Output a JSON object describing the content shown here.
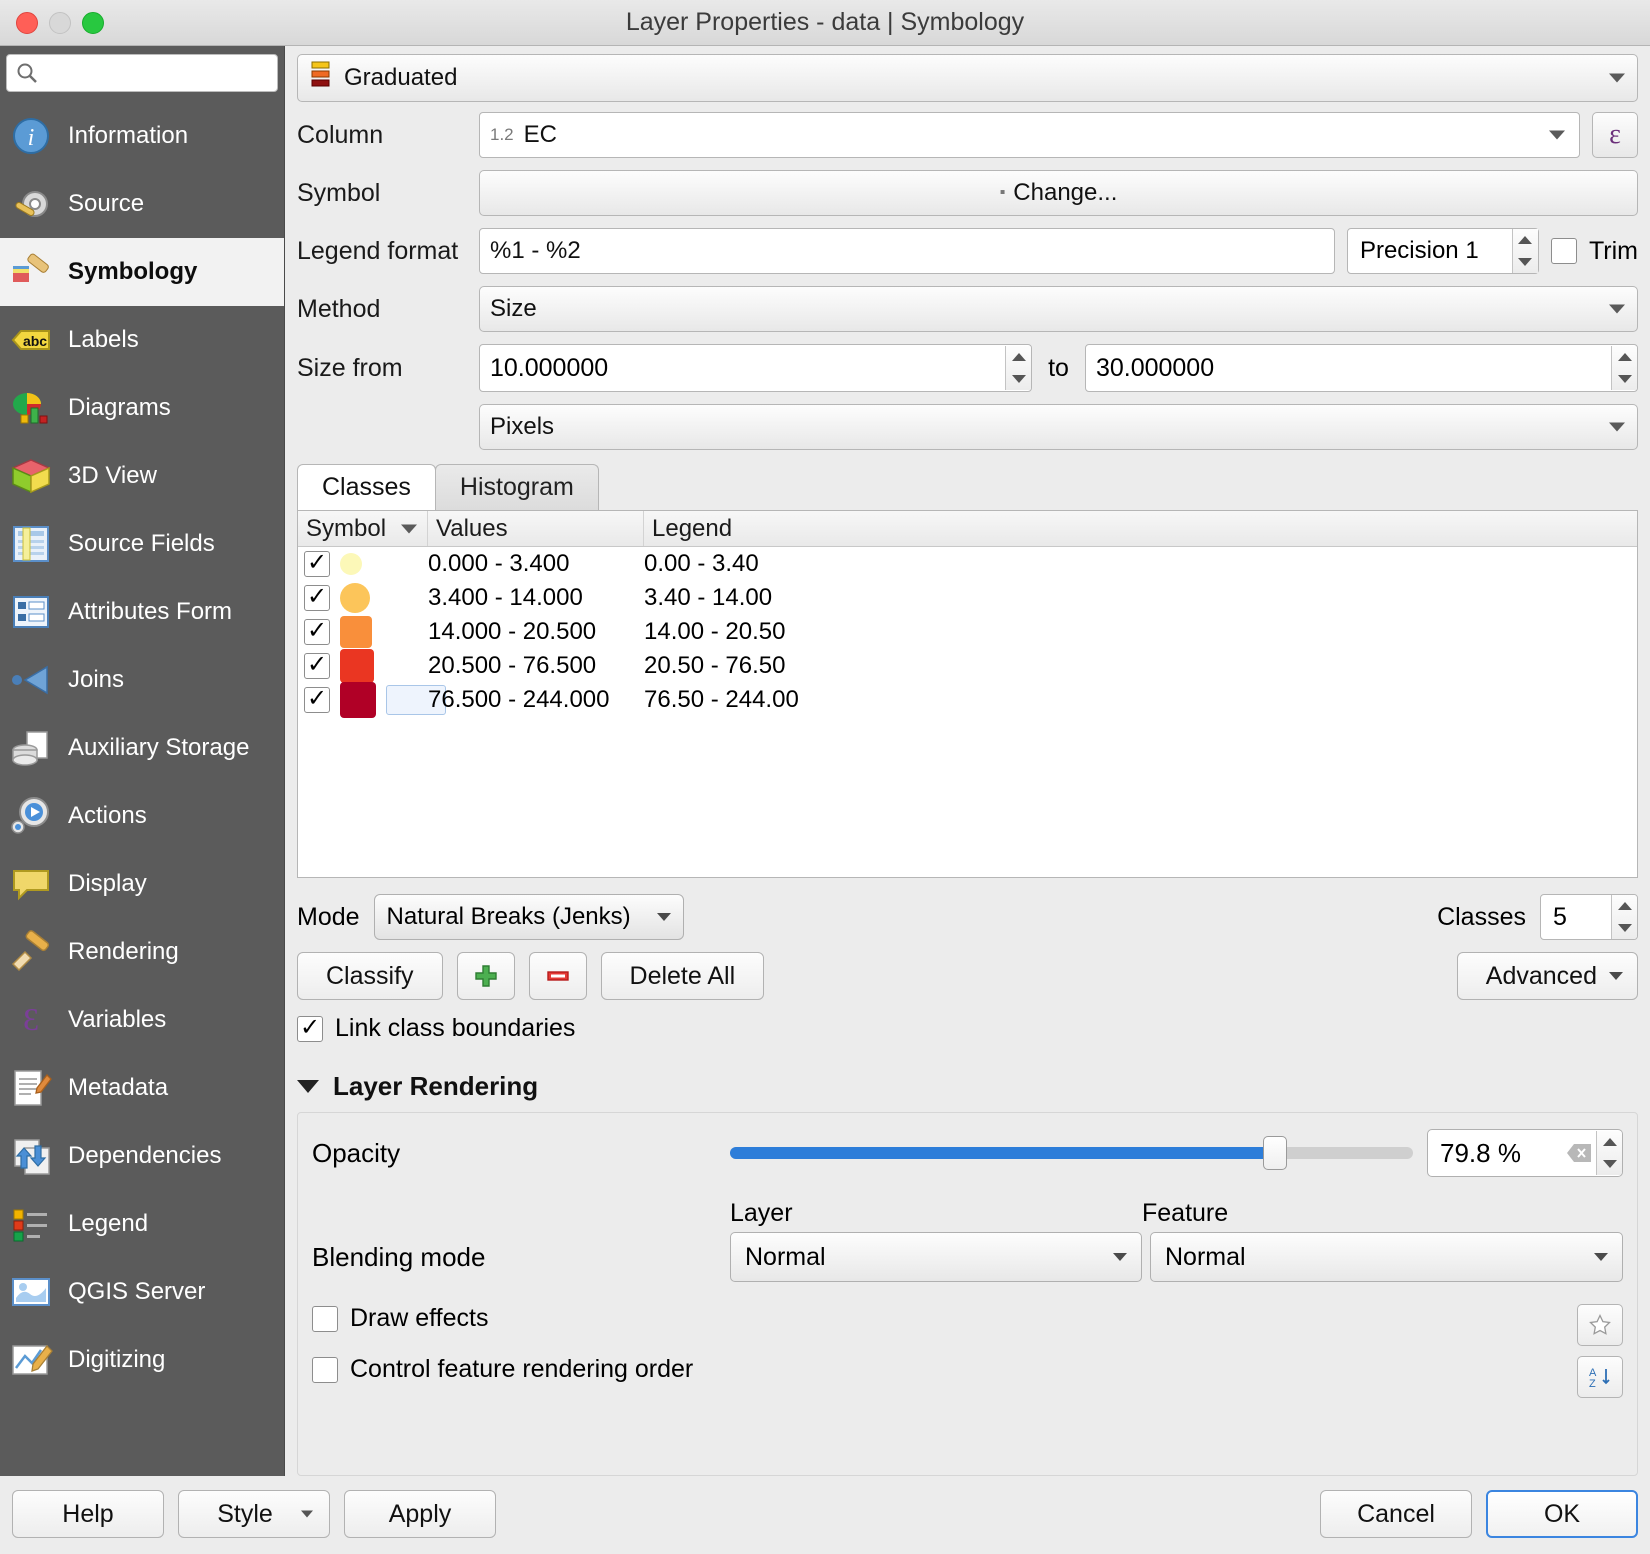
{
  "window": {
    "title": "Layer Properties - data | Symbology",
    "controls": {
      "close": "close",
      "minimize": "minimize",
      "zoom": "zoom"
    }
  },
  "sidebar": {
    "search_placeholder": "",
    "items": [
      {
        "label": "Information",
        "icon": "information-icon",
        "active": false
      },
      {
        "label": "Source",
        "icon": "source-icon",
        "active": false
      },
      {
        "label": "Symbology",
        "icon": "symbology-icon",
        "active": true
      },
      {
        "label": "Labels",
        "icon": "labels-icon",
        "active": false
      },
      {
        "label": "Diagrams",
        "icon": "diagrams-icon",
        "active": false
      },
      {
        "label": "3D View",
        "icon": "3d-view-icon",
        "active": false
      },
      {
        "label": "Source Fields",
        "icon": "source-fields-icon",
        "active": false
      },
      {
        "label": "Attributes Form",
        "icon": "attributes-form-icon",
        "active": false
      },
      {
        "label": "Joins",
        "icon": "joins-icon",
        "active": false
      },
      {
        "label": "Auxiliary Storage",
        "icon": "auxiliary-storage-icon",
        "active": false
      },
      {
        "label": "Actions",
        "icon": "actions-icon",
        "active": false
      },
      {
        "label": "Display",
        "icon": "display-icon",
        "active": false
      },
      {
        "label": "Rendering",
        "icon": "rendering-icon",
        "active": false
      },
      {
        "label": "Variables",
        "icon": "variables-icon",
        "active": false
      },
      {
        "label": "Metadata",
        "icon": "metadata-icon",
        "active": false
      },
      {
        "label": "Dependencies",
        "icon": "dependencies-icon",
        "active": false
      },
      {
        "label": "Legend",
        "icon": "legend-icon",
        "active": false
      },
      {
        "label": "QGIS Server",
        "icon": "qgis-server-icon",
        "active": false
      },
      {
        "label": "Digitizing",
        "icon": "digitizing-icon",
        "active": false
      }
    ]
  },
  "renderer": {
    "value": "Graduated"
  },
  "form": {
    "column_label": "Column",
    "column_prefix": "1.2",
    "column_value": "EC",
    "expression_button": "ε",
    "symbol_label": "Symbol",
    "symbol_button": "Change...",
    "legend_format_label": "Legend format",
    "legend_format_value": "%1 - %2",
    "precision_value": "Precision 1",
    "trim_label": "Trim",
    "trim_checked": false,
    "method_label": "Method",
    "method_value": "Size",
    "size_from_label": "Size from",
    "size_from_value": "10.000000",
    "size_to_label": "to",
    "size_to_value": "30.000000",
    "units_value": "Pixels"
  },
  "tabs": [
    {
      "label": "Classes",
      "active": true
    },
    {
      "label": "Histogram",
      "active": false
    }
  ],
  "table": {
    "headers": {
      "symbol": "Symbol",
      "values": "Values",
      "legend": "Legend"
    },
    "rows": [
      {
        "checked": true,
        "color": "#fcf8b8",
        "shape": "circle",
        "size": 22,
        "values": "0.000 - 3.400",
        "legend": "0.00 - 3.40",
        "editing": false
      },
      {
        "checked": true,
        "color": "#fcc55a",
        "shape": "circle",
        "size": 30,
        "values": "3.400 - 14.000",
        "legend": "3.40 - 14.00",
        "editing": false
      },
      {
        "checked": true,
        "color": "#f98f3b",
        "shape": "square",
        "size": 32,
        "values": "14.000 - 20.500",
        "legend": "14.00 - 20.50",
        "editing": false
      },
      {
        "checked": true,
        "color": "#ea3622",
        "shape": "square",
        "size": 34,
        "values": "20.500 - 76.500",
        "legend": "20.50 - 76.50",
        "editing": false
      },
      {
        "checked": true,
        "color": "#b00026",
        "shape": "square",
        "size": 36,
        "values": "76.500 - 244.000",
        "legend": "76.50 - 244.00",
        "editing": true
      }
    ]
  },
  "classify": {
    "mode_label": "Mode",
    "mode_value": "Natural Breaks (Jenks)",
    "classes_label": "Classes",
    "classes_value": "5",
    "classify_button": "Classify",
    "add_button": "add-class-icon",
    "remove_button": "remove-class-icon",
    "delete_all_button": "Delete All",
    "advanced_button": "Advanced",
    "link_class_boundaries_label": "Link class boundaries",
    "link_class_boundaries_checked": true
  },
  "layer_rendering": {
    "section_title": "Layer Rendering",
    "opacity_label": "Opacity",
    "opacity_value": "79.8 %",
    "opacity_percent": 79.8,
    "blending_label": "Blending mode",
    "layer_col_label": "Layer",
    "feature_col_label": "Feature",
    "layer_blend_value": "Normal",
    "feature_blend_value": "Normal",
    "draw_effects_label": "Draw effects",
    "draw_effects_checked": false,
    "control_order_label": "Control feature rendering order",
    "control_order_checked": false,
    "star_button": "star-icon",
    "sort_button": "sort-order-icon"
  },
  "footer": {
    "help": "Help",
    "style": "Style",
    "apply": "Apply",
    "cancel": "Cancel",
    "ok": "OK"
  },
  "colors": {
    "accent": "#2d7dd9",
    "sidebar_bg": "#5b5b5b",
    "panel_bg": "#ececec"
  }
}
